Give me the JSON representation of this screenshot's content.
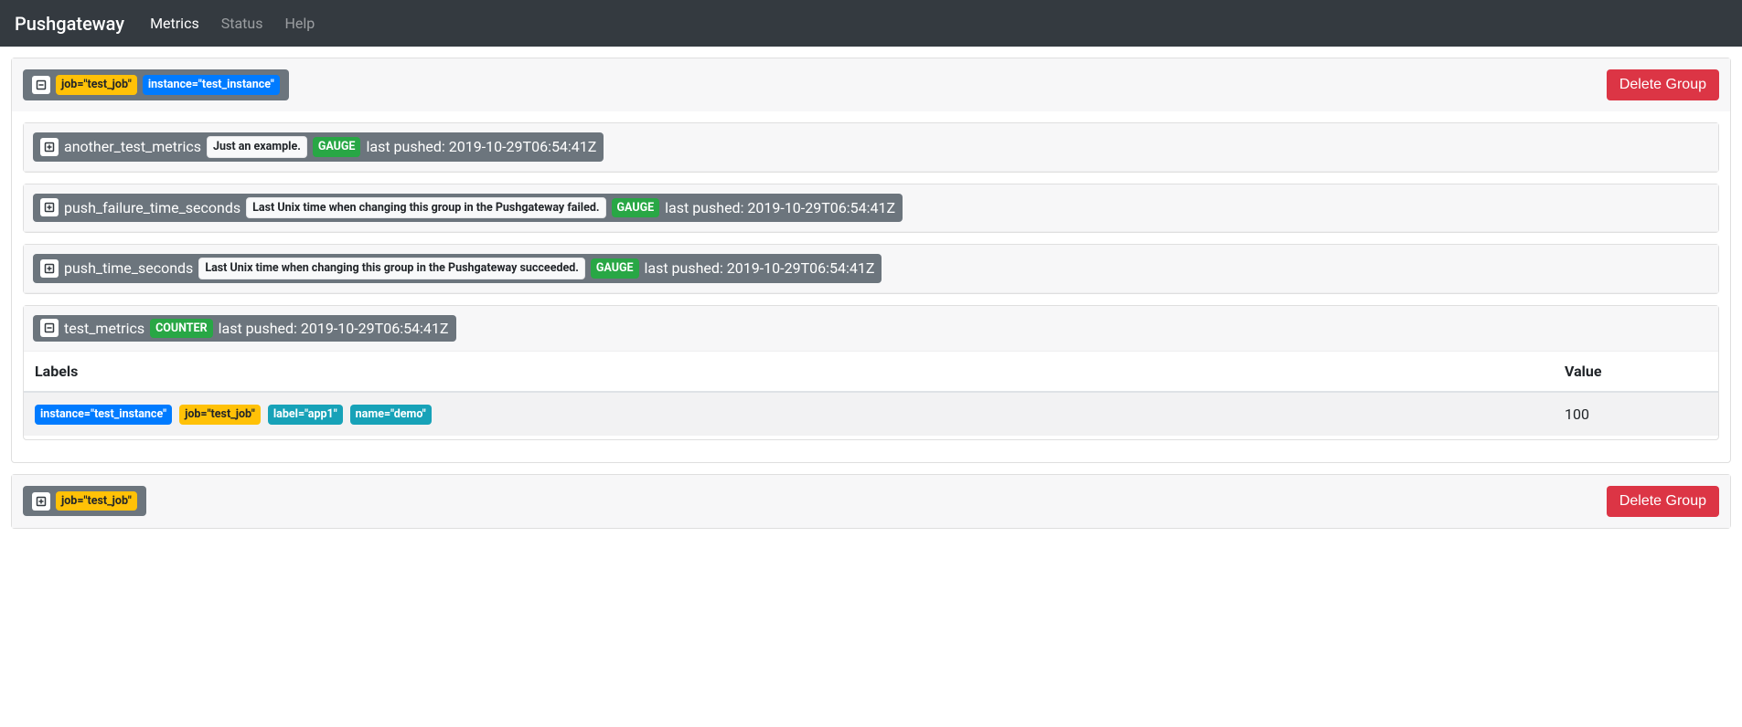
{
  "nav": {
    "brand": "Pushgateway",
    "links": [
      {
        "label": "Metrics",
        "active": true
      },
      {
        "label": "Status",
        "active": false
      },
      {
        "label": "Help",
        "active": false
      }
    ]
  },
  "delete_group_label": "Delete Group",
  "last_pushed_prefix": "last pushed: ",
  "table": {
    "labels_header": "Labels",
    "value_header": "Value"
  },
  "groups": [
    {
      "labels": [
        {
          "text": "job=\"test_job\"",
          "style": "warning"
        },
        {
          "text": "instance=\"test_instance\"",
          "style": "primary"
        }
      ],
      "expanded": true,
      "metrics": [
        {
          "name": "another_test_metrics",
          "help": "Just an example.",
          "type": "GAUGE",
          "last_pushed": "2019-10-29T06:54:41Z",
          "expanded": false
        },
        {
          "name": "push_failure_time_seconds",
          "help": "Last Unix time when changing this group in the Pushgateway failed.",
          "type": "GAUGE",
          "last_pushed": "2019-10-29T06:54:41Z",
          "expanded": false
        },
        {
          "name": "push_time_seconds",
          "help": "Last Unix time when changing this group in the Pushgateway succeeded.",
          "type": "GAUGE",
          "last_pushed": "2019-10-29T06:54:41Z",
          "expanded": false
        },
        {
          "name": "test_metrics",
          "help": "",
          "type": "COUNTER",
          "last_pushed": "2019-10-29T06:54:41Z",
          "expanded": true,
          "rows": [
            {
              "labels": [
                {
                  "text": "instance=\"test_instance\"",
                  "style": "primary"
                },
                {
                  "text": "job=\"test_job\"",
                  "style": "warning"
                },
                {
                  "text": "label=\"app1\"",
                  "style": "info"
                },
                {
                  "text": "name=\"demo\"",
                  "style": "info"
                }
              ],
              "value": "100"
            }
          ]
        }
      ]
    },
    {
      "labels": [
        {
          "text": "job=\"test_job\"",
          "style": "warning"
        }
      ],
      "expanded": false,
      "metrics": []
    }
  ]
}
